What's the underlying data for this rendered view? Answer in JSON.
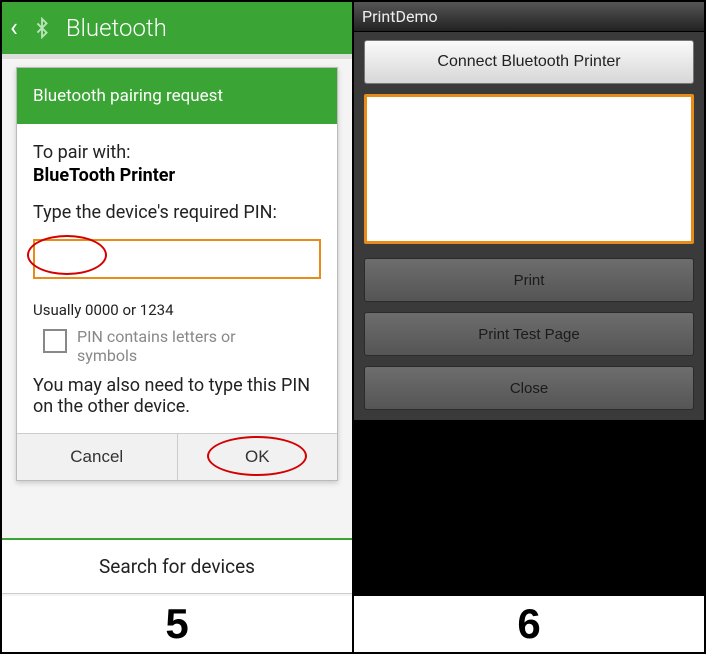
{
  "left": {
    "header": {
      "title": "Bluetooth"
    },
    "dialog": {
      "title": "Bluetooth pairing request",
      "pair_with_label": "To pair with:",
      "device_name": "BlueTooth Printer",
      "prompt": "Type the device's required PIN:",
      "pin_value": "",
      "hint": "Usually 0000 or 1234",
      "checkbox_label": "PIN contains letters or symbols",
      "checkbox_checked": false,
      "note": "You may also need to type this PIN on the other device.",
      "cancel_label": "Cancel",
      "ok_label": "OK"
    },
    "footer_label": "Search for devices",
    "caption": "5"
  },
  "right": {
    "app_title": "PrintDemo",
    "connect_label": "Connect Bluetooth Printer",
    "textarea_value": "",
    "print_label": "Print",
    "print_test_label": "Print Test Page",
    "close_label": "Close",
    "caption": "6"
  },
  "colors": {
    "brand_green": "#3aa435",
    "focus_orange": "#e78c1a",
    "annot_red": "#d30000"
  }
}
